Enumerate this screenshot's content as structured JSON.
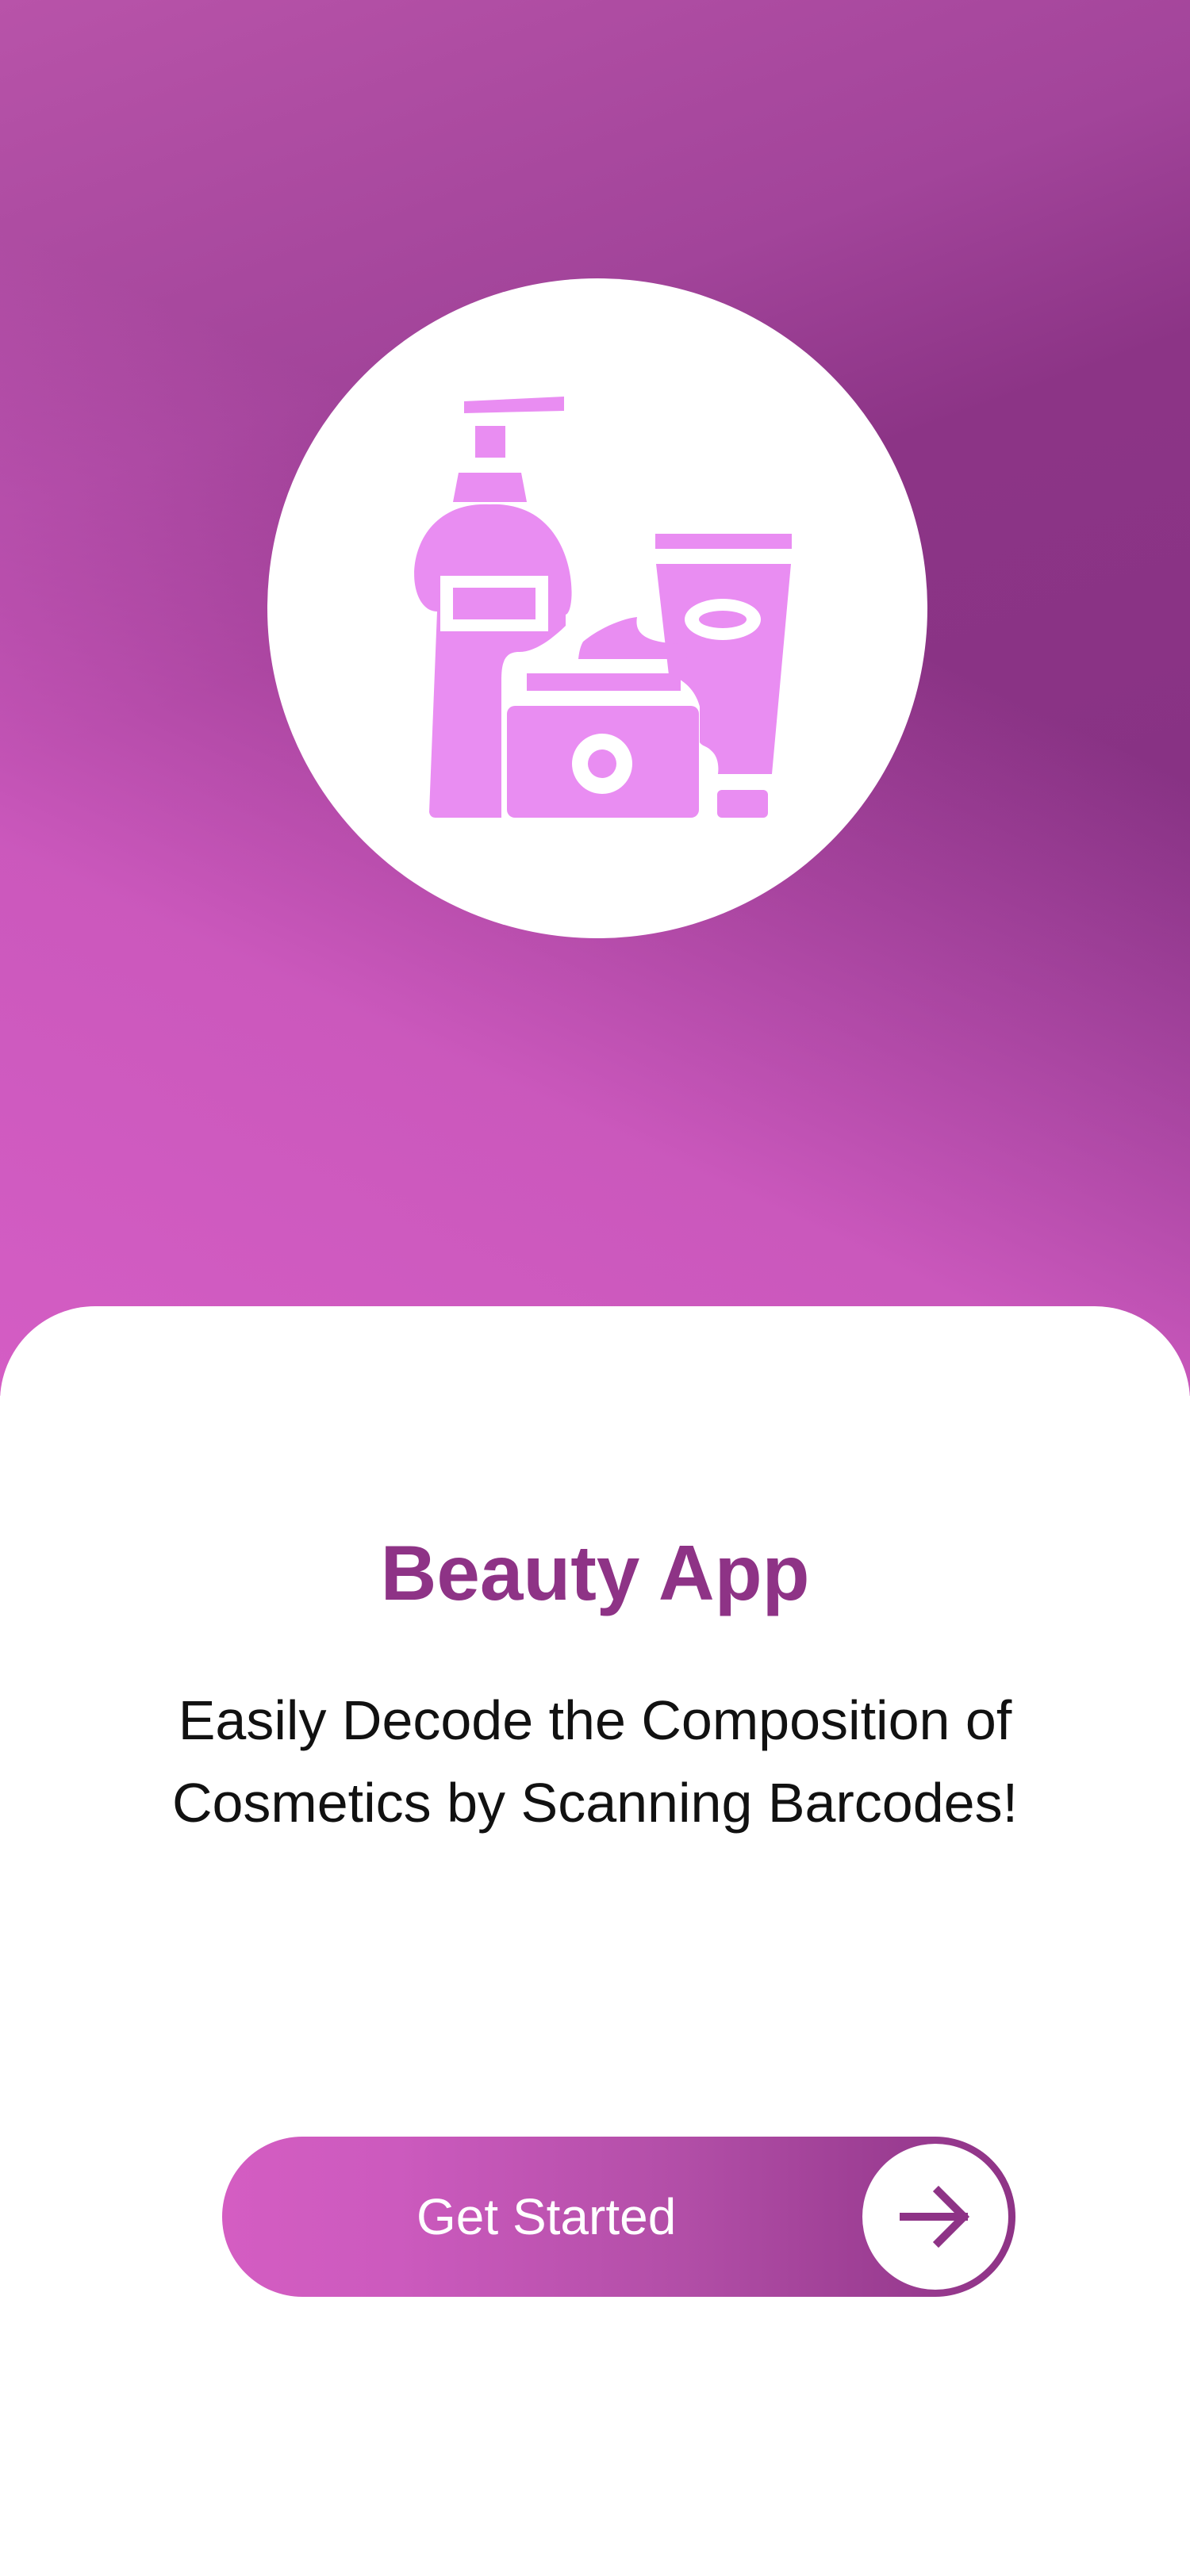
{
  "app": {
    "title": "Beauty App",
    "subtitle": "Easily Decode the Composition of Cosmetics by Scanning Barcodes!"
  },
  "cta": {
    "label": "Get Started",
    "icon": "arrow-right-icon"
  },
  "hero": {
    "icon": "cosmetics-icon"
  },
  "colors": {
    "accent": "#8e3386",
    "gradient_start": "#d45dc2",
    "gradient_end": "#8a3385",
    "icon_fill": "#e98df2",
    "text": "#111111"
  }
}
